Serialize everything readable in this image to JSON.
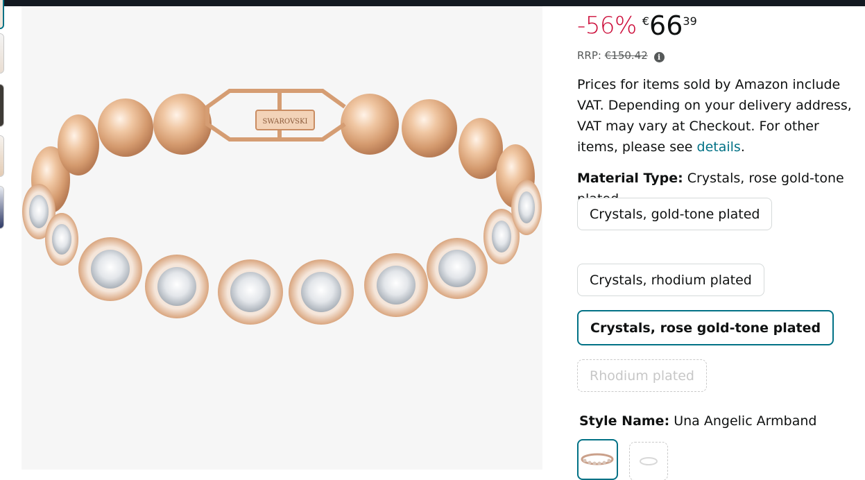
{
  "price": {
    "discount": "-56%",
    "currency": "€",
    "whole": "66",
    "fraction": "39"
  },
  "rrp": {
    "label": "RRP:",
    "value": "€150.42",
    "info_icon": "info-icon"
  },
  "vat": {
    "text": "Prices for items sold by Amazon include VAT. Depending on your delivery address, VAT may vary at Checkout. For other items, please see ",
    "link": "details",
    "end": "."
  },
  "material": {
    "label": "Material Type:",
    "value": "Crystals, rose gold-tone plated",
    "options": [
      {
        "label": "Crystals, gold-tone plated",
        "state": "available"
      },
      {
        "label": "Crystals, rhodium plated",
        "state": "available"
      },
      {
        "label": "Crystals, rose gold-tone plated",
        "state": "selected"
      },
      {
        "label": "Rhodium plated",
        "state": "unavailable"
      }
    ]
  },
  "style": {
    "label": "Style Name:",
    "value": "Una Angelic Armband"
  },
  "product_image": {
    "clasp_text": "SWAROVSKI"
  },
  "colors": {
    "accent": "#007185",
    "discount": "#cc0c39",
    "header": "#131921",
    "gold": "#e8b68f"
  }
}
